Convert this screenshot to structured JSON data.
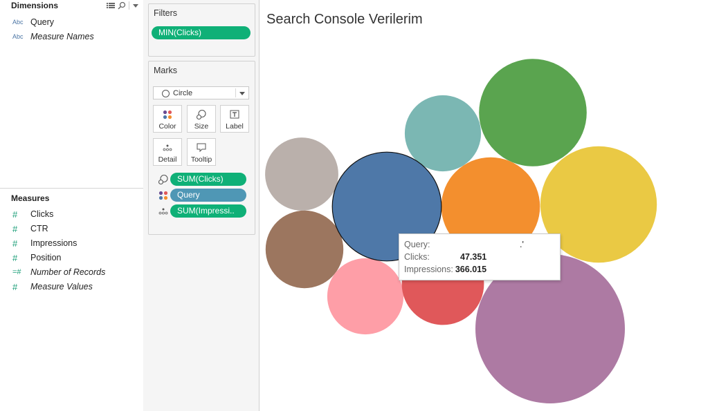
{
  "data_pane": {
    "dimensions_title": "Dimensions",
    "dimensions": [
      {
        "type": "Abc",
        "label": "Query",
        "italic": false
      },
      {
        "type": "Abc",
        "label": "Measure Names",
        "italic": true
      }
    ],
    "measures_title": "Measures",
    "measures": [
      {
        "label": "Clicks",
        "italic": false
      },
      {
        "label": "CTR",
        "italic": false
      },
      {
        "label": "Impressions",
        "italic": false
      },
      {
        "label": "Position",
        "italic": false
      },
      {
        "label": "Number of Records",
        "italic": true
      },
      {
        "label": "Measure Values",
        "italic": true
      }
    ],
    "hash_symbol": "#",
    "calc_hash_symbol": "=#"
  },
  "filters": {
    "title": "Filters",
    "pill": "MIN(Clicks)"
  },
  "marks": {
    "title": "Marks",
    "mark_type": "Circle",
    "buttons": [
      "Color",
      "Size",
      "Label",
      "Detail",
      "Tooltip"
    ],
    "fields": [
      {
        "icon": "size-icon",
        "label": "SUM(Clicks)",
        "color": "green"
      },
      {
        "icon": "color-icon",
        "label": "Query",
        "color": "blue"
      },
      {
        "icon": "detail-icon",
        "label": "SUM(Impressi..",
        "color": "green"
      }
    ]
  },
  "viz": {
    "title": "Search Console Verilerim"
  },
  "tooltip": {
    "query_label": "Query:",
    "query_value": ".'",
    "clicks_label": "Clicks:",
    "clicks_value": "47.351",
    "impressions_label": "Impressions:",
    "impressions_value": "366.015"
  },
  "chart_data": {
    "type": "packed-bubble",
    "title": "Search Console Verilerim",
    "size_field": "SUM(Clicks)",
    "color_field": "Query",
    "series": [
      {
        "color": "#ad7aa3",
        "relative_size": 1.0
      },
      {
        "color": "#eac944",
        "relative_size": 0.78
      },
      {
        "color": "#5aa44f",
        "relative_size": 0.72
      },
      {
        "color": "#4e78a8",
        "relative_size": 0.73,
        "highlighted": true,
        "clicks": "47.351",
        "impressions": "366.015"
      },
      {
        "color": "#f38f2e",
        "relative_size": 0.66
      },
      {
        "color": "#7bb7b3",
        "relative_size": 0.51
      },
      {
        "color": "#bab0ab",
        "relative_size": 0.49
      },
      {
        "color": "#9c765f",
        "relative_size": 0.52
      },
      {
        "color": "#fe9ea7",
        "relative_size": 0.51
      },
      {
        "color": "#e0585a",
        "relative_size": 0.55
      }
    ]
  }
}
